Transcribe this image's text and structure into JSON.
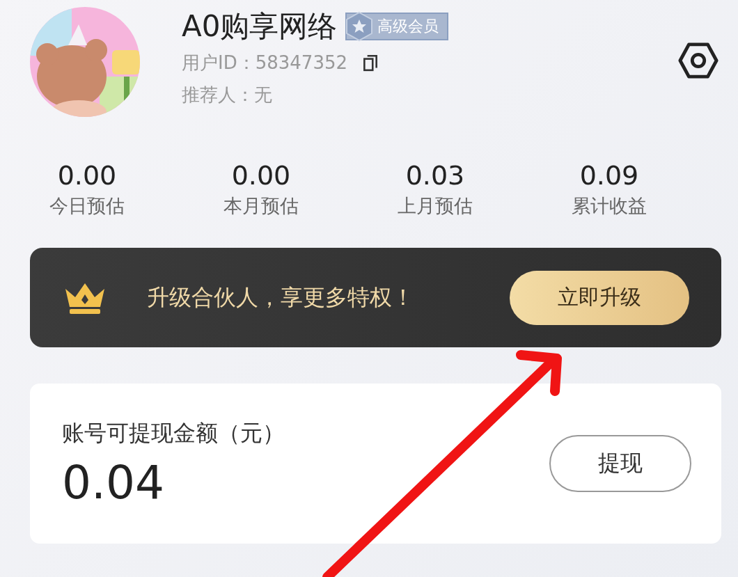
{
  "profile": {
    "name": "A0购享网络",
    "badge": "高级会员",
    "user_id_label": "用户ID：",
    "user_id": "58347352",
    "referrer_label": "推荐人：",
    "referrer": "无"
  },
  "stats": [
    {
      "value": "0.00",
      "label": "今日预估"
    },
    {
      "value": "0.00",
      "label": "本月预估"
    },
    {
      "value": "0.03",
      "label": "上月预估"
    },
    {
      "value": "0.09",
      "label": "累计收益"
    }
  ],
  "upgrade_banner": {
    "text": "升级合伙人，享更多特权！",
    "button": "立即升级"
  },
  "balance": {
    "label": "账号可提现金额（元）",
    "amount": "0.04",
    "button": "提现"
  }
}
